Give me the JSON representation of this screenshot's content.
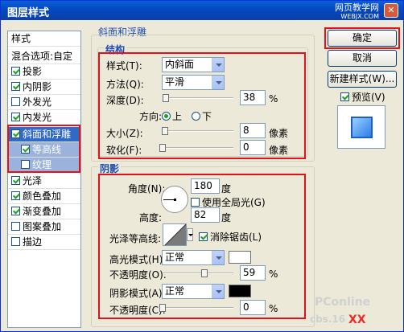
{
  "window": {
    "title": "图层样式",
    "watermark": "网页教学网",
    "watermark_sub": "WEBJX.COM"
  },
  "stylelist": {
    "header": "样式",
    "blend": "混合选项:自定",
    "items": [
      {
        "label": "投影",
        "checked": true
      },
      {
        "label": "内阴影",
        "checked": true
      },
      {
        "label": "外发光",
        "checked": false
      },
      {
        "label": "内发光",
        "checked": true
      },
      {
        "label": "斜面和浮雕",
        "checked": true
      },
      {
        "label": "等高线",
        "checked": true
      },
      {
        "label": "纹理",
        "checked": false
      },
      {
        "label": "光泽",
        "checked": true
      },
      {
        "label": "颜色叠加",
        "checked": true
      },
      {
        "label": "渐变叠加",
        "checked": true
      },
      {
        "label": "图案叠加",
        "checked": false
      },
      {
        "label": "描边",
        "checked": false
      }
    ]
  },
  "bevel": {
    "section_title": "斜面和浮雕",
    "structure": {
      "title": "结构",
      "style_label": "样式(T):",
      "style_value": "内斜面",
      "method_label": "方法(Q):",
      "method_value": "平滑",
      "depth_label": "深度(D):",
      "depth_value": "38",
      "depth_unit": "%",
      "depth_fraction": 0.04,
      "direction_label": "方向:",
      "dir_up": "上",
      "dir_down": "下",
      "size_label": "大小(Z):",
      "size_value": "8",
      "size_unit": "像素",
      "size_fraction": 0.03,
      "soften_label": "软化(F):",
      "soften_value": "0",
      "soften_unit": "像素",
      "soften_fraction": 0.0
    },
    "shading": {
      "title": "阴影",
      "angle_label": "角度(N):",
      "angle_value": "180",
      "angle_unit": "度",
      "global_light": "使用全局光(G)",
      "altitude_label": "高度:",
      "altitude_value": "82",
      "altitude_unit": "度",
      "gloss_label": "光泽等高线:",
      "antialias": "消除锯齿(L)",
      "highlight_label": "高光模式(H):",
      "highlight_mode": "正常",
      "highlight_color": "#ffffff",
      "hl_opacity_label": "不透明度(O):",
      "hl_opacity_value": "59",
      "hl_opacity_unit": "%",
      "hl_opacity_fraction": 0.59,
      "shadow_label": "阴影模式(A):",
      "shadow_mode": "正常",
      "shadow_color": "#000000",
      "sh_opacity_label": "不透明度(C):",
      "sh_opacity_value": "0",
      "sh_opacity_unit": "%",
      "sh_opacity_fraction": 0.0
    }
  },
  "buttons": {
    "ok": "确定",
    "cancel": "取消",
    "new_style": "新建样式(W)...",
    "preview": "预览(V)"
  },
  "footer_watermark": {
    "brand": "PConline",
    "site": "cbs.16",
    "tag": "XX"
  }
}
